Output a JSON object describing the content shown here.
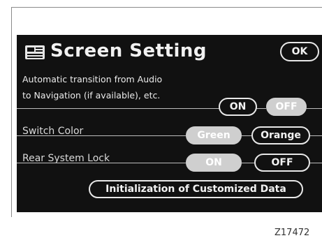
{
  "header": {
    "icon": "screen-settings-icon",
    "title": "Screen Setting",
    "ok_label": "OK"
  },
  "auto_transition": {
    "line1": "Automatic transition from Audio",
    "line2": "to Navigation (if available), etc.",
    "on_label": "ON",
    "off_label": "OFF",
    "selected": "OFF"
  },
  "switch_color": {
    "label": "Switch Color",
    "green_label": "Green",
    "orange_label": "Orange",
    "selected": "Green"
  },
  "rear_lock": {
    "label": "Rear System Lock",
    "on_label": "ON",
    "off_label": "OFF",
    "selected": "ON"
  },
  "init_label": "Initialization of Customized Data",
  "figure_code": "Z17472",
  "colors": {
    "screen_bg": "#111111",
    "selected_fill": "#cfcfcf",
    "text": "#f2f2f2"
  }
}
